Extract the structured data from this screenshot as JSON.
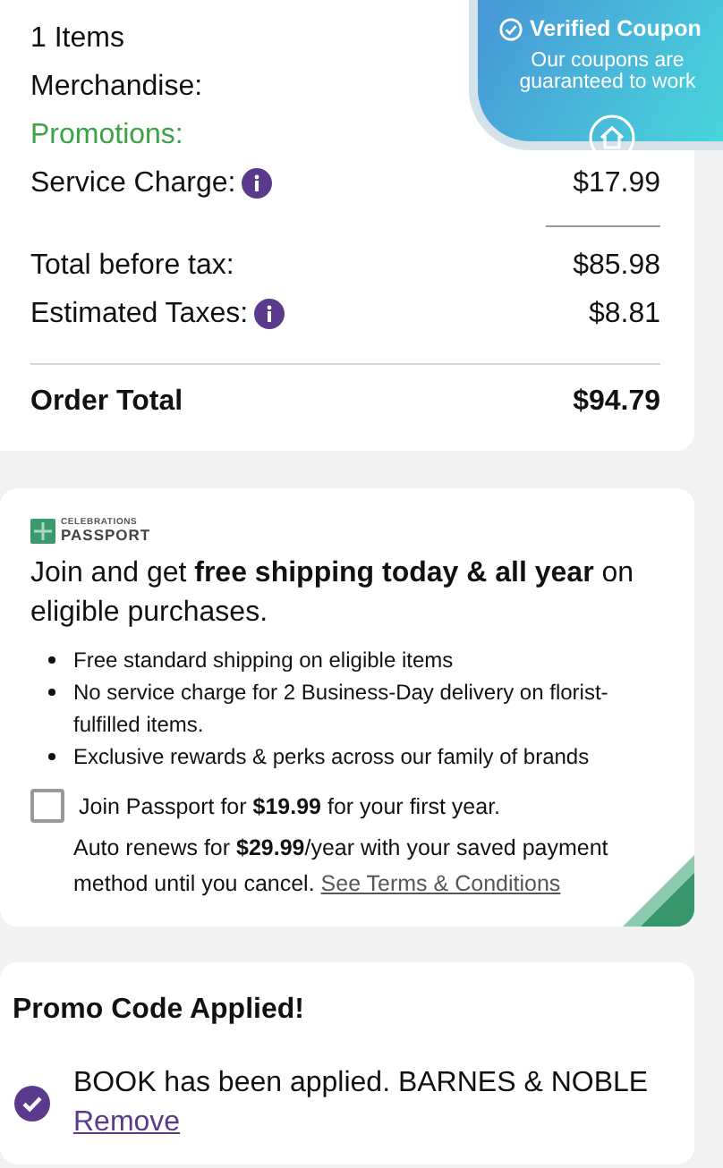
{
  "summary": {
    "items_count": "1 Items",
    "rows": [
      {
        "label": "Merchandise:",
        "kind": "plain"
      },
      {
        "label": "Promotions:",
        "kind": "promo"
      },
      {
        "label": "Service Charge:",
        "value": "$17.99",
        "kind": "info"
      }
    ],
    "subtotal_rows": [
      {
        "label": "Total before tax:",
        "value": "$85.98",
        "kind": "plain"
      },
      {
        "label": "Estimated Taxes:",
        "value": "$8.81",
        "kind": "info"
      }
    ],
    "total": {
      "label": "Order Total",
      "value": "$94.79"
    }
  },
  "coupon_badge": {
    "title": "Verified Coupon",
    "text": "Our coupons are guaranteed to work"
  },
  "passport": {
    "logo_small": "CELEBRATIONS",
    "logo_big": "PASSPORT",
    "headline": "Join and get **free shipping today & all year** on eligible purchases.",
    "benefits": [
      "Free standard shipping on eligible items",
      "No service charge for 2 Business-Day delivery on florist-fulfilled items.",
      "Exclusive rewards & perks across our family of brands"
    ],
    "join": {
      "checked": false,
      "text": "Join Passport for **$19.99** for your first year."
    },
    "renewal": "Auto renews for **$29.99**/year with your saved payment method until you cancel.",
    "terms_link": "See Terms & Conditions"
  },
  "promo": {
    "title": "Promo Code Applied!",
    "message": "BOOK has been applied. BARNES & NOBLE",
    "remove_link": "Remove"
  }
}
